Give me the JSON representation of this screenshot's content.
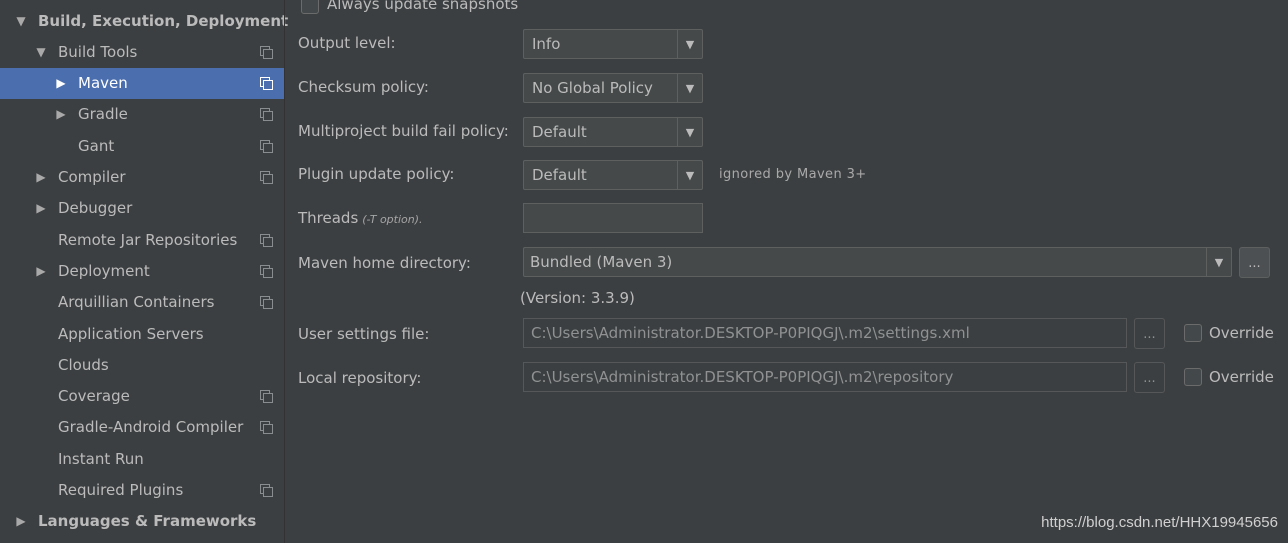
{
  "sidebar": {
    "items": [
      {
        "label": "Build, Execution, Deployment",
        "expanded": true,
        "level": 0,
        "bold": true,
        "copy_icon": false
      },
      {
        "label": "Build Tools",
        "expanded": true,
        "level": 1,
        "copy_icon": true
      },
      {
        "label": "Maven",
        "expanded": false,
        "level": 2,
        "selected": true,
        "copy_icon": true
      },
      {
        "label": "Gradle",
        "expanded": false,
        "level": 2,
        "copy_icon": true
      },
      {
        "label": "Gant",
        "level": 2,
        "copy_icon": true
      },
      {
        "label": "Compiler",
        "expanded": false,
        "level": 1,
        "copy_icon": true
      },
      {
        "label": "Debugger",
        "expanded": false,
        "level": 1,
        "copy_icon": false
      },
      {
        "label": "Remote Jar Repositories",
        "level": 1,
        "copy_icon": true
      },
      {
        "label": "Deployment",
        "expanded": false,
        "level": 1,
        "copy_icon": true
      },
      {
        "label": "Arquillian Containers",
        "level": 1,
        "copy_icon": true
      },
      {
        "label": "Application Servers",
        "level": 1,
        "copy_icon": false
      },
      {
        "label": "Clouds",
        "level": 1,
        "copy_icon": false
      },
      {
        "label": "Coverage",
        "level": 1,
        "copy_icon": true
      },
      {
        "label": "Gradle-Android Compiler",
        "level": 1,
        "copy_icon": true
      },
      {
        "label": "Instant Run",
        "level": 1,
        "copy_icon": false
      },
      {
        "label": "Required Plugins",
        "level": 1,
        "copy_icon": true
      },
      {
        "label": "Languages & Frameworks",
        "expanded": false,
        "level": 0,
        "bold": true,
        "copy_icon": false
      }
    ]
  },
  "form": {
    "always_update_snapshots": {
      "label": "Always update snapshots",
      "checked": false
    },
    "output_level": {
      "label": "Output level:",
      "value": "Info"
    },
    "checksum_policy": {
      "label": "Checksum policy:",
      "value": "No Global Policy"
    },
    "multiproject_fail_policy": {
      "label": "Multiproject build fail policy:",
      "value": "Default"
    },
    "plugin_update_policy": {
      "label": "Plugin update policy:",
      "value": "Default",
      "note": "ignored by Maven 3+"
    },
    "threads": {
      "label": "Threads",
      "hint": "(-T option).",
      "value": ""
    },
    "maven_home": {
      "label": "Maven home directory:",
      "value": "Bundled (Maven 3)",
      "browse": "..."
    },
    "maven_version": "(Version: 3.3.9)",
    "user_settings": {
      "label": "User settings file:",
      "value": "C:\\Users\\Administrator.DESKTOP-P0PIQGJ\\.m2\\settings.xml",
      "browse": "...",
      "override_label": "Override",
      "override_checked": false
    },
    "local_repository": {
      "label": "Local repository:",
      "value": "C:\\Users\\Administrator.DESKTOP-P0PIQGJ\\.m2\\repository",
      "browse": "...",
      "override_label": "Override",
      "override_checked": false
    }
  },
  "watermark": "https://blog.csdn.net/HHX19945656",
  "colors": {
    "background": "#3c3f41",
    "selection": "#4b6eaf",
    "field_background": "#45494a",
    "text": "#bbbbbb"
  }
}
